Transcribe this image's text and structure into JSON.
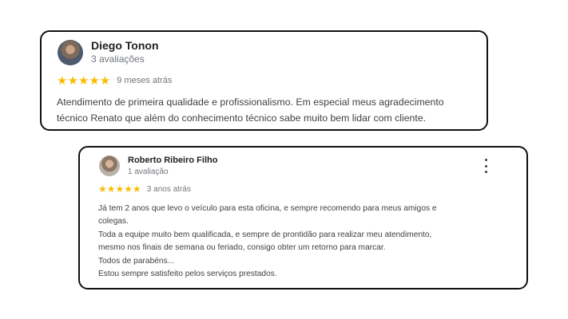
{
  "reviews": [
    {
      "author": "Diego Tonon",
      "review_count": "3 avaliações",
      "stars": "★★★★★",
      "rating": 5,
      "time_ago": "9 meses atrás",
      "lines": [
        "Atendimento de primeira qualidade e profissionalismo. Em especial meus agradecimento",
        "técnico Renato que além do conhecimento técnico sabe muito bem lidar com cliente."
      ]
    },
    {
      "author": "Roberto Ribeiro Filho",
      "review_count": "1 avaliação",
      "stars": "★★★★★",
      "rating": 5,
      "time_ago": "3 anos atrás",
      "lines": [
        "Já tem 2 anos que levo o veículo para esta oficina, e sempre recomendo para meus amigos e",
        "colegas.",
        "Toda a equipe muito bem qualificada, e sempre de prontidão para realizar meu atendimento,",
        "mesmo nos finais de semana ou feriado, consigo obter um retorno para marcar.",
        "Todos de parabéns...",
        "Estou sempre satisfeito pelos serviços prestados."
      ]
    }
  ],
  "colors": {
    "star": "#fbbc04",
    "border": "#111111",
    "meta": "#70757a"
  },
  "icons": {
    "menu": "more-vert-icon"
  }
}
